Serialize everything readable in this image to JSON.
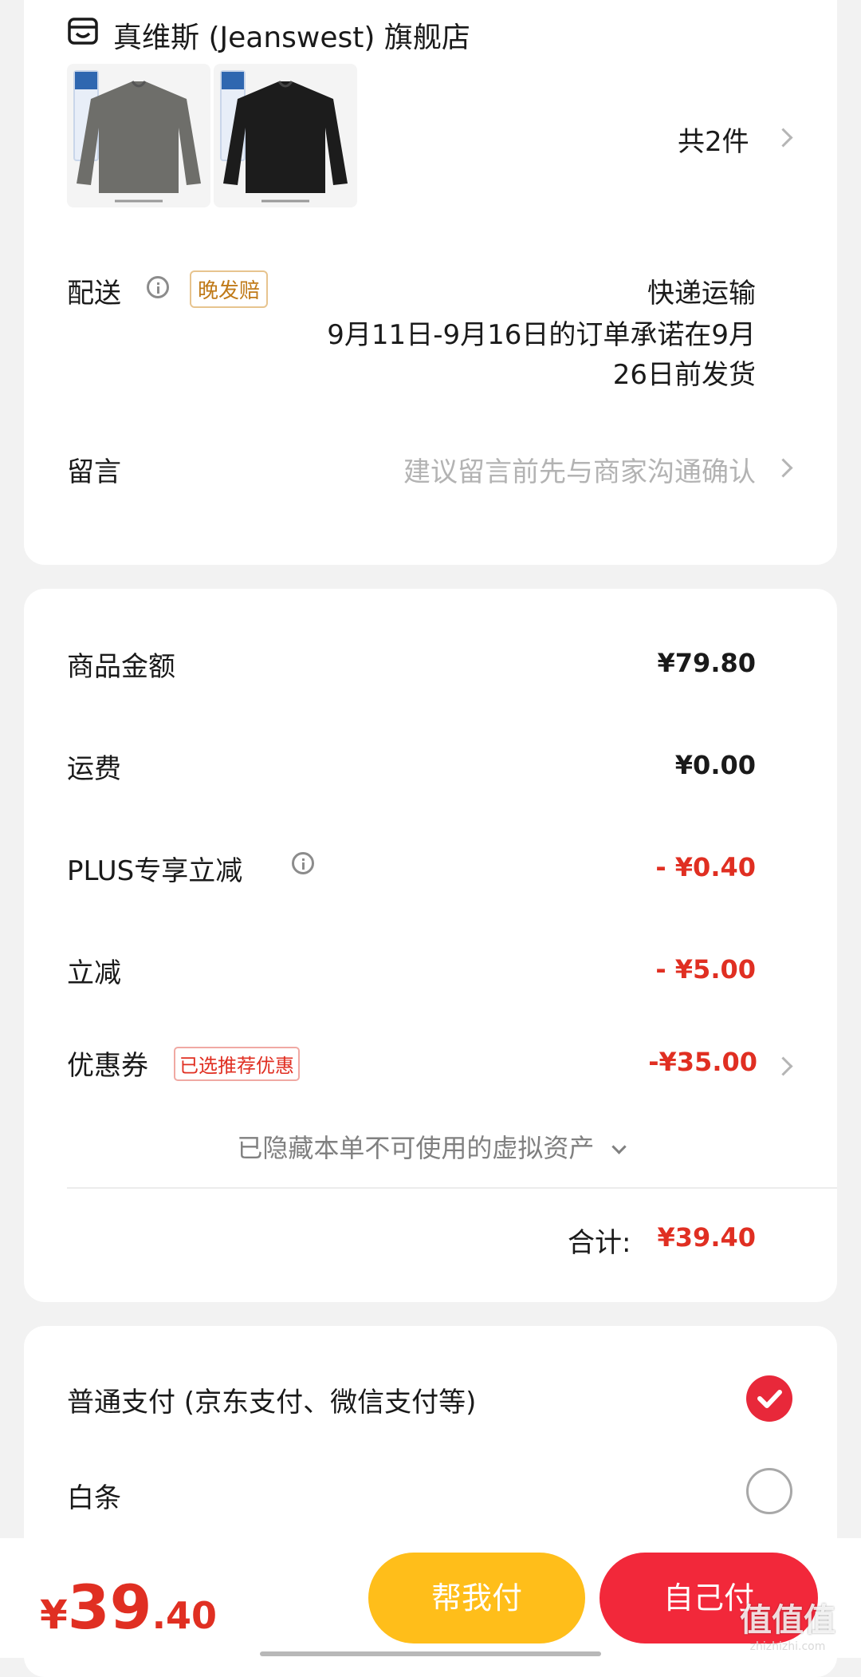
{
  "store": {
    "icon": "store-icon",
    "name": "真维斯 (Jeanswest) 旗舰店"
  },
  "items": {
    "products": [
      {
        "color": "#6e6e6a"
      },
      {
        "color": "#1c1c1c"
      }
    ],
    "count_text": "共2件"
  },
  "delivery": {
    "label": "配送",
    "badge": "晚发赔",
    "method": "快递运输",
    "promise_line1": "9月11日-9月16日的订单承诺在9月",
    "promise_line2": "26日前发货"
  },
  "message": {
    "label": "留言",
    "placeholder": "建议留言前先与商家沟通确认"
  },
  "price_details": {
    "goods_amount": {
      "label": "商品金额",
      "value": "¥79.80"
    },
    "shipping": {
      "label": "运费",
      "value": "¥0.00"
    },
    "plus_discount": {
      "label": "PLUS专享立减",
      "value": "- ¥0.40"
    },
    "instant_discount": {
      "label": "立减",
      "value": "- ¥5.00"
    },
    "coupon": {
      "label": "优惠券",
      "badge": "已选推荐优惠",
      "value": "-¥35.00"
    },
    "hidden_assets": "已隐藏本单不可使用的虚拟资产",
    "total_label": "合计:",
    "total_value": "¥39.40"
  },
  "payment": {
    "option_normal": "普通支付 (京东支付、微信支付等)",
    "option_baitiao": "白条",
    "selected": "normal"
  },
  "bottom_bar": {
    "currency": "¥",
    "price_int": "39",
    "price_dec": ".40",
    "help_pay": "帮我付",
    "self_pay": "自己付",
    "watermark": "值值值",
    "watermark_url": "zhizhizhi.com"
  },
  "colors": {
    "accent_red": "#e02f22",
    "help_yellow": "#ffbe1a",
    "self_red": "#f2283a"
  }
}
